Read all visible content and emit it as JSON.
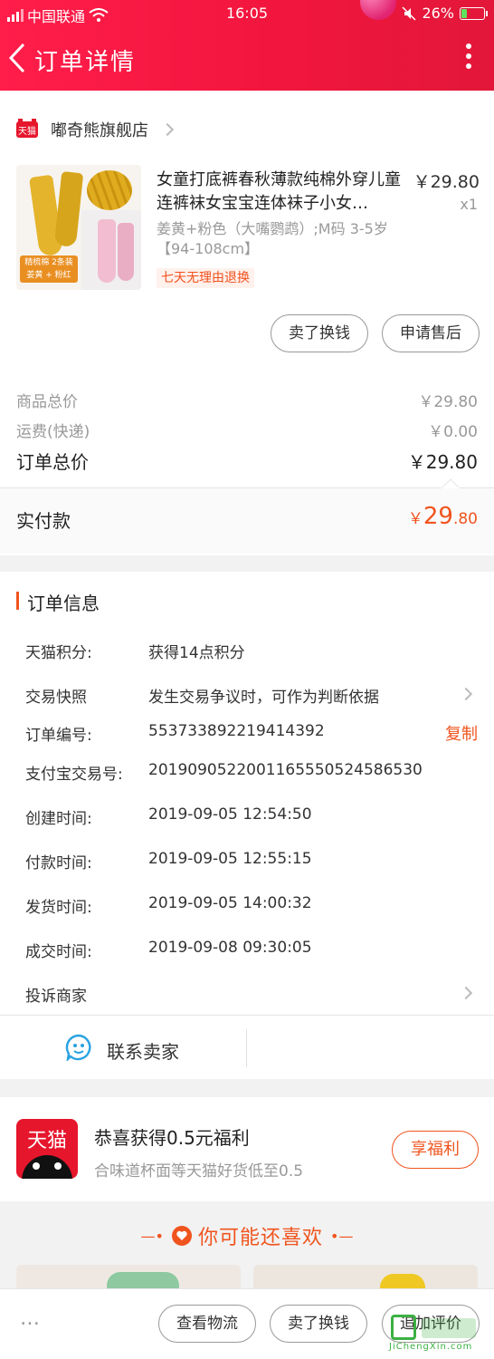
{
  "status_bar": {
    "carrier": "中国联通",
    "time": "16:05",
    "battery": "26%",
    "battery_level": 0.26
  },
  "header": {
    "title": "订单详情"
  },
  "shop": {
    "name": "嘟奇熊旗舰店",
    "logo_text": "天猫"
  },
  "product": {
    "title": "女童打底裤春秋薄款纯棉外穿儿童连裤袜女宝宝连体袜子小女…",
    "price": "￥29.80",
    "quantity": "x1",
    "spec": "姜黄+粉色（大嘴鹦鹉）;M码 3-5岁【94-108cm】",
    "return_badge": "七天无理由退换",
    "thumb_tag_line1": "精梳棉 2条装",
    "thumb_tag_line2": "姜黄 + 粉红"
  },
  "item_actions": {
    "resell": "卖了换钱",
    "after_sale": "申请售后"
  },
  "pricing": {
    "goods_total_label": "商品总价",
    "goods_total": "￥29.80",
    "shipping_label": "运费(快递)",
    "shipping": "￥0.00",
    "order_total_label": "订单总价",
    "order_total": "￥29.80",
    "paid_label": "实付款",
    "paid_symbol": "￥",
    "paid_int": "29",
    "paid_dec": ".80"
  },
  "order_info": {
    "section_title": "订单信息",
    "points_label": "天猫积分:",
    "points": "获得14点积分",
    "snapshot_label": "交易快照",
    "snapshot": "发生交易争议时，可作为判断依据",
    "order_no_label": "订单编号:",
    "order_no": "553733892219414392",
    "copy": "复制",
    "alipay_label": "支付宝交易号:",
    "alipay_no": "2019090522001165550524586530",
    "created_label": "创建时间:",
    "created": "2019-09-05 12:54:50",
    "paid_time_label": "付款时间:",
    "paid_time": "2019-09-05 12:55:15",
    "shipped_label": "发货时间:",
    "shipped": "2019-09-05 14:00:32",
    "done_label": "成交时间:",
    "done": "2019-09-08 09:30:05",
    "complaint_label": "投诉商家"
  },
  "contact": {
    "label": "联系卖家"
  },
  "promo": {
    "logo_text": "天猫",
    "title": "恭喜获得0.5元福利",
    "subtitle": "合味道杯面等天猫好货低至0.5",
    "button": "享福利"
  },
  "recommend": {
    "title": "你可能还喜欢"
  },
  "footer": {
    "more": "…",
    "logistics": "查看物流",
    "resell": "卖了换钱",
    "review": "追加评价",
    "watermark_en": "JiChengXin.com"
  },
  "colors": {
    "brand_red": "#f2163e",
    "accent_orange": "#f0541e"
  }
}
